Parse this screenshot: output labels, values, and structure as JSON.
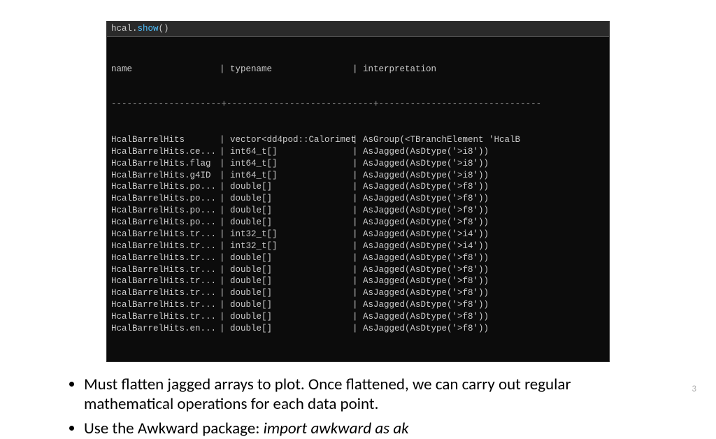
{
  "code": {
    "obj": "hcal.",
    "method": "show",
    "paren": "()"
  },
  "columns": {
    "name": "name",
    "typename": "typename",
    "interpretation": "interpretation"
  },
  "divider": "---------------------+----------------------------+-------------------------------",
  "rows": [
    {
      "name": "HcalBarrelHits",
      "typename": "vector<dd4pod::Calorimet",
      "interpretation": "AsGroup(<TBranchElement 'HcalB"
    },
    {
      "name": "HcalBarrelHits.ce...",
      "typename": "int64_t[]",
      "interpretation": "AsJagged(AsDtype('>i8'))"
    },
    {
      "name": "HcalBarrelHits.flag",
      "typename": "int64_t[]",
      "interpretation": "AsJagged(AsDtype('>i8'))"
    },
    {
      "name": "HcalBarrelHits.g4ID",
      "typename": "int64_t[]",
      "interpretation": "AsJagged(AsDtype('>i8'))"
    },
    {
      "name": "HcalBarrelHits.po...",
      "typename": "double[]",
      "interpretation": "AsJagged(AsDtype('>f8'))"
    },
    {
      "name": "HcalBarrelHits.po...",
      "typename": "double[]",
      "interpretation": "AsJagged(AsDtype('>f8'))"
    },
    {
      "name": "HcalBarrelHits.po...",
      "typename": "double[]",
      "interpretation": "AsJagged(AsDtype('>f8'))"
    },
    {
      "name": "HcalBarrelHits.po...",
      "typename": "double[]",
      "interpretation": "AsJagged(AsDtype('>f8'))"
    },
    {
      "name": "HcalBarrelHits.tr...",
      "typename": "int32_t[]",
      "interpretation": "AsJagged(AsDtype('>i4'))"
    },
    {
      "name": "HcalBarrelHits.tr...",
      "typename": "int32_t[]",
      "interpretation": "AsJagged(AsDtype('>i4'))"
    },
    {
      "name": "HcalBarrelHits.tr...",
      "typename": "double[]",
      "interpretation": "AsJagged(AsDtype('>f8'))"
    },
    {
      "name": "HcalBarrelHits.tr...",
      "typename": "double[]",
      "interpretation": "AsJagged(AsDtype('>f8'))"
    },
    {
      "name": "HcalBarrelHits.tr...",
      "typename": "double[]",
      "interpretation": "AsJagged(AsDtype('>f8'))"
    },
    {
      "name": "HcalBarrelHits.tr...",
      "typename": "double[]",
      "interpretation": "AsJagged(AsDtype('>f8'))"
    },
    {
      "name": "HcalBarrelHits.tr...",
      "typename": "double[]",
      "interpretation": "AsJagged(AsDtype('>f8'))"
    },
    {
      "name": "HcalBarrelHits.tr...",
      "typename": "double[]",
      "interpretation": "AsJagged(AsDtype('>f8'))"
    },
    {
      "name": "HcalBarrelHits.en...",
      "typename": "double[]",
      "interpretation": "AsJagged(AsDtype('>f8'))"
    }
  ],
  "bullets": {
    "b1": "Must flatten jagged arrays to plot. Once flattened, we can carry out regular mathematical operations for each data point.",
    "b2_prefix": "Use the Awkward package: ",
    "b2_italic": "import awkward as ak"
  },
  "page_number": "3"
}
